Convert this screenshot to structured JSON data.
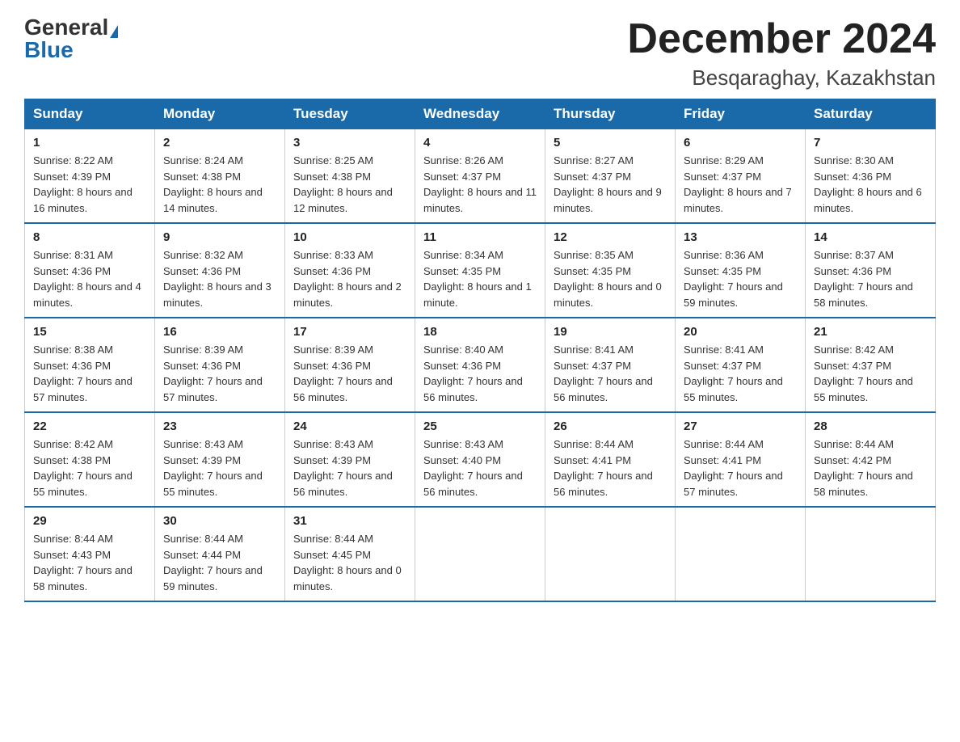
{
  "header": {
    "logo_general": "General",
    "logo_blue": "Blue",
    "month_title": "December 2024",
    "location": "Besqaraghay, Kazakhstan"
  },
  "days_of_week": [
    "Sunday",
    "Monday",
    "Tuesday",
    "Wednesday",
    "Thursday",
    "Friday",
    "Saturday"
  ],
  "weeks": [
    [
      {
        "day": "1",
        "sunrise": "8:22 AM",
        "sunset": "4:39 PM",
        "daylight": "8 hours and 16 minutes."
      },
      {
        "day": "2",
        "sunrise": "8:24 AM",
        "sunset": "4:38 PM",
        "daylight": "8 hours and 14 minutes."
      },
      {
        "day": "3",
        "sunrise": "8:25 AM",
        "sunset": "4:38 PM",
        "daylight": "8 hours and 12 minutes."
      },
      {
        "day": "4",
        "sunrise": "8:26 AM",
        "sunset": "4:37 PM",
        "daylight": "8 hours and 11 minutes."
      },
      {
        "day": "5",
        "sunrise": "8:27 AM",
        "sunset": "4:37 PM",
        "daylight": "8 hours and 9 minutes."
      },
      {
        "day": "6",
        "sunrise": "8:29 AM",
        "sunset": "4:37 PM",
        "daylight": "8 hours and 7 minutes."
      },
      {
        "day": "7",
        "sunrise": "8:30 AM",
        "sunset": "4:36 PM",
        "daylight": "8 hours and 6 minutes."
      }
    ],
    [
      {
        "day": "8",
        "sunrise": "8:31 AM",
        "sunset": "4:36 PM",
        "daylight": "8 hours and 4 minutes."
      },
      {
        "day": "9",
        "sunrise": "8:32 AM",
        "sunset": "4:36 PM",
        "daylight": "8 hours and 3 minutes."
      },
      {
        "day": "10",
        "sunrise": "8:33 AM",
        "sunset": "4:36 PM",
        "daylight": "8 hours and 2 minutes."
      },
      {
        "day": "11",
        "sunrise": "8:34 AM",
        "sunset": "4:35 PM",
        "daylight": "8 hours and 1 minute."
      },
      {
        "day": "12",
        "sunrise": "8:35 AM",
        "sunset": "4:35 PM",
        "daylight": "8 hours and 0 minutes."
      },
      {
        "day": "13",
        "sunrise": "8:36 AM",
        "sunset": "4:35 PM",
        "daylight": "7 hours and 59 minutes."
      },
      {
        "day": "14",
        "sunrise": "8:37 AM",
        "sunset": "4:36 PM",
        "daylight": "7 hours and 58 minutes."
      }
    ],
    [
      {
        "day": "15",
        "sunrise": "8:38 AM",
        "sunset": "4:36 PM",
        "daylight": "7 hours and 57 minutes."
      },
      {
        "day": "16",
        "sunrise": "8:39 AM",
        "sunset": "4:36 PM",
        "daylight": "7 hours and 57 minutes."
      },
      {
        "day": "17",
        "sunrise": "8:39 AM",
        "sunset": "4:36 PM",
        "daylight": "7 hours and 56 minutes."
      },
      {
        "day": "18",
        "sunrise": "8:40 AM",
        "sunset": "4:36 PM",
        "daylight": "7 hours and 56 minutes."
      },
      {
        "day": "19",
        "sunrise": "8:41 AM",
        "sunset": "4:37 PM",
        "daylight": "7 hours and 56 minutes."
      },
      {
        "day": "20",
        "sunrise": "8:41 AM",
        "sunset": "4:37 PM",
        "daylight": "7 hours and 55 minutes."
      },
      {
        "day": "21",
        "sunrise": "8:42 AM",
        "sunset": "4:37 PM",
        "daylight": "7 hours and 55 minutes."
      }
    ],
    [
      {
        "day": "22",
        "sunrise": "8:42 AM",
        "sunset": "4:38 PM",
        "daylight": "7 hours and 55 minutes."
      },
      {
        "day": "23",
        "sunrise": "8:43 AM",
        "sunset": "4:39 PM",
        "daylight": "7 hours and 55 minutes."
      },
      {
        "day": "24",
        "sunrise": "8:43 AM",
        "sunset": "4:39 PM",
        "daylight": "7 hours and 56 minutes."
      },
      {
        "day": "25",
        "sunrise": "8:43 AM",
        "sunset": "4:40 PM",
        "daylight": "7 hours and 56 minutes."
      },
      {
        "day": "26",
        "sunrise": "8:44 AM",
        "sunset": "4:41 PM",
        "daylight": "7 hours and 56 minutes."
      },
      {
        "day": "27",
        "sunrise": "8:44 AM",
        "sunset": "4:41 PM",
        "daylight": "7 hours and 57 minutes."
      },
      {
        "day": "28",
        "sunrise": "8:44 AM",
        "sunset": "4:42 PM",
        "daylight": "7 hours and 58 minutes."
      }
    ],
    [
      {
        "day": "29",
        "sunrise": "8:44 AM",
        "sunset": "4:43 PM",
        "daylight": "7 hours and 58 minutes."
      },
      {
        "day": "30",
        "sunrise": "8:44 AM",
        "sunset": "4:44 PM",
        "daylight": "7 hours and 59 minutes."
      },
      {
        "day": "31",
        "sunrise": "8:44 AM",
        "sunset": "4:45 PM",
        "daylight": "8 hours and 0 minutes."
      },
      null,
      null,
      null,
      null
    ]
  ],
  "labels": {
    "sunrise": "Sunrise:",
    "sunset": "Sunset:",
    "daylight": "Daylight:"
  }
}
